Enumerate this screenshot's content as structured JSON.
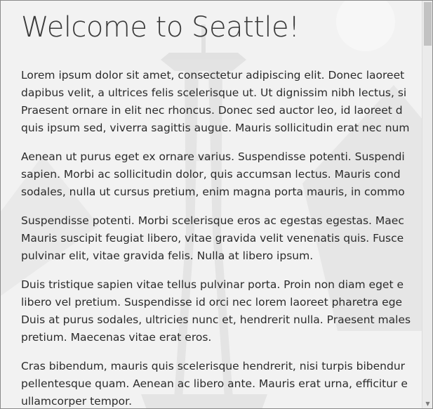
{
  "page": {
    "title": "Welcome to Seattle!"
  },
  "paragraphs": [
    {
      "lines": [
        "Lorem ipsum dolor sit amet, consectetur adipiscing elit. Donec laoreet",
        "dapibus velit, a ultrices felis scelerisque ut. Ut dignissim nibh lectus, si",
        "Praesent ornare in elit nec rhoncus. Donec sed auctor leo, id laoreet d",
        "quis ipsum sed, viverra sagittis augue. Mauris sollicitudin erat nec num"
      ]
    },
    {
      "lines": [
        "Aenean ut purus eget ex ornare varius. Suspendisse potenti. Suspendi",
        "sapien. Morbi ac sollicitudin dolor, quis accumsan lectus. Mauris cond",
        "sodales, nulla ut cursus pretium, enim magna porta mauris, in commo"
      ]
    },
    {
      "lines": [
        "Suspendisse potenti. Morbi scelerisque eros ac egestas egestas. Maec",
        "Mauris suscipit feugiat libero, vitae gravida velit venenatis quis. Fusce",
        "pulvinar elit, vitae gravida felis. Nulla at libero ipsum."
      ]
    },
    {
      "lines": [
        "Duis tristique sapien vitae tellus pulvinar porta. Proin non diam eget e",
        "libero vel pretium. Suspendisse id orci nec lorem laoreet pharetra ege",
        "Duis at purus sodales, ultricies nunc et, hendrerit nulla. Praesent males",
        "pretium. Maecenas vitae erat eros."
      ]
    },
    {
      "lines": [
        "Cras bibendum, mauris quis scelerisque hendrerit, nisi turpis bibendur",
        "pellentesque quam. Aenean ac libero ante. Mauris erat urna, efficitur e",
        "ullamcorper tempor."
      ]
    }
  ],
  "background": {
    "image": "space-needle-illustration",
    "color": "#f2f2f2",
    "shape_color": "#e4e4e4"
  },
  "scrollbar": {
    "arrow_icon": "scroll-down-arrow-icon"
  }
}
